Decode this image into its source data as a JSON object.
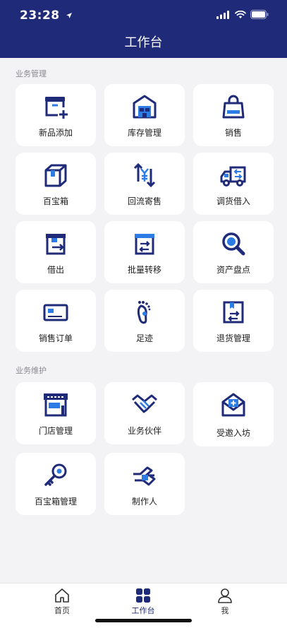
{
  "status": {
    "time": "23:28"
  },
  "header": {
    "title": "工作台"
  },
  "sections": {
    "business_management": "业务管理",
    "business_maintenance": "业务维护"
  },
  "grid": {
    "new_item": "新品添加",
    "inventory": "库存管理",
    "sales": "销售",
    "treasure_box": "百宝箱",
    "return_consign": "回流寄售",
    "transfer_borrow": "调货借入",
    "lend_out": "借出",
    "batch_transfer": "批量转移",
    "asset_check": "资产盘点",
    "sales_order": "销售订单",
    "footprint": "足迹",
    "return_management": "退货管理",
    "store_management": "门店管理",
    "partner": "业务伙伴",
    "invited": "受邀入坊",
    "treasure_box_management": "百宝箱管理",
    "maker": "制作人"
  },
  "tabs": {
    "home": "首页",
    "workbench": "工作台",
    "me": "我"
  },
  "colors": {
    "primary": "#1f2a78",
    "accent": "#2d7be5",
    "background": "#f3f3f5"
  }
}
